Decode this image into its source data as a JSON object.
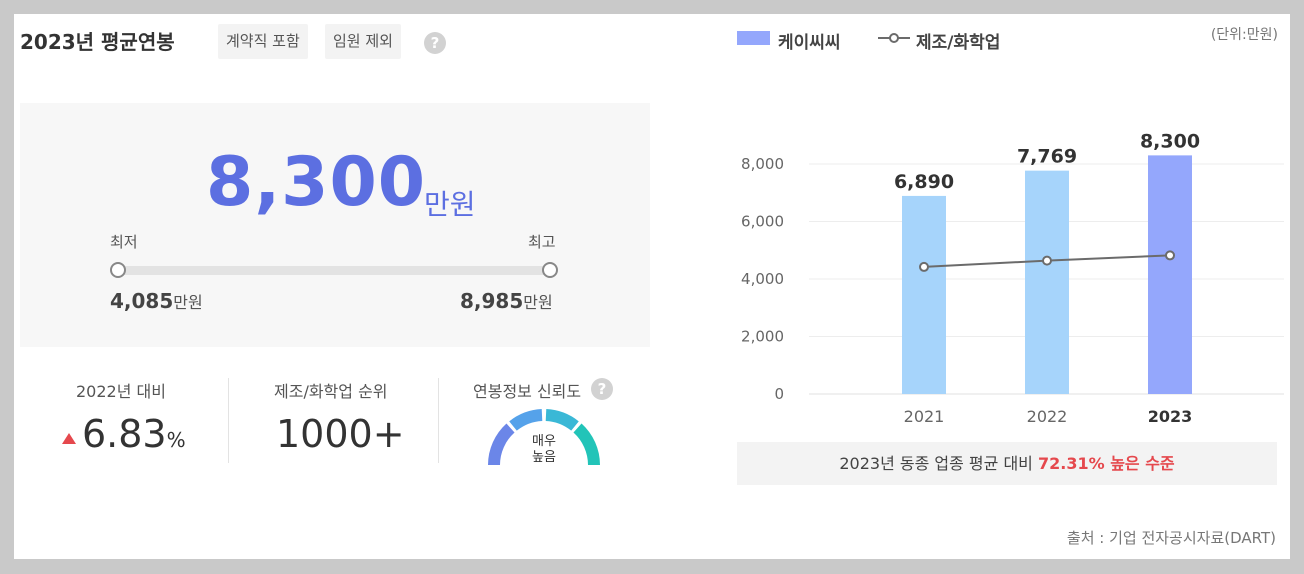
{
  "header": {
    "title": "2023년 평균연봉",
    "tags": [
      "계약직 포함",
      "임원 제외"
    ],
    "help": "?"
  },
  "salary": {
    "value": "8,300",
    "unit": "만원",
    "min_label": "최저",
    "max_label": "최고",
    "min_value": "4,085",
    "max_value": "8,985",
    "value_unit": "만원"
  },
  "stats": {
    "yoy_label": "2022년 대비",
    "yoy_value": "6.83",
    "yoy_unit": "%",
    "rank_label": "제조/화학업 순위",
    "rank_value": "1000+",
    "trust_label": "연봉정보 신뢰도",
    "trust_value_line1": "매우",
    "trust_value_line2": "높음"
  },
  "legend": {
    "company": "케이씨씨",
    "industry": "제조/화학업",
    "unit_note": "(단위:만원)"
  },
  "summary": {
    "prefix": "2023년 동종 업종 평균 대비",
    "highlight": "72.31% 높은 수준"
  },
  "source": "출처 : 기업 전자공시자료(DART)",
  "colors": {
    "accent": "#5c6fe1",
    "bar_light": "#a6d4fb",
    "bar_dark": "#94a7fc",
    "line": "#6b6b6b",
    "up": "#e5484d"
  },
  "chart_data": {
    "type": "bar",
    "categories": [
      "2021",
      "2022",
      "2023"
    ],
    "series": [
      {
        "name": "케이씨씨",
        "type": "bar",
        "values": [
          6890,
          7769,
          8300
        ]
      },
      {
        "name": "제조/화학업",
        "type": "line",
        "values": [
          4420,
          4640,
          4820
        ]
      }
    ],
    "value_labels": [
      "6,890",
      "7,769",
      "8,300"
    ],
    "y_ticks": [
      "0",
      "2,000",
      "4,000",
      "6,000",
      "8,000"
    ],
    "ylim": [
      0,
      9000
    ],
    "grid": true,
    "highlight_category": "2023"
  }
}
